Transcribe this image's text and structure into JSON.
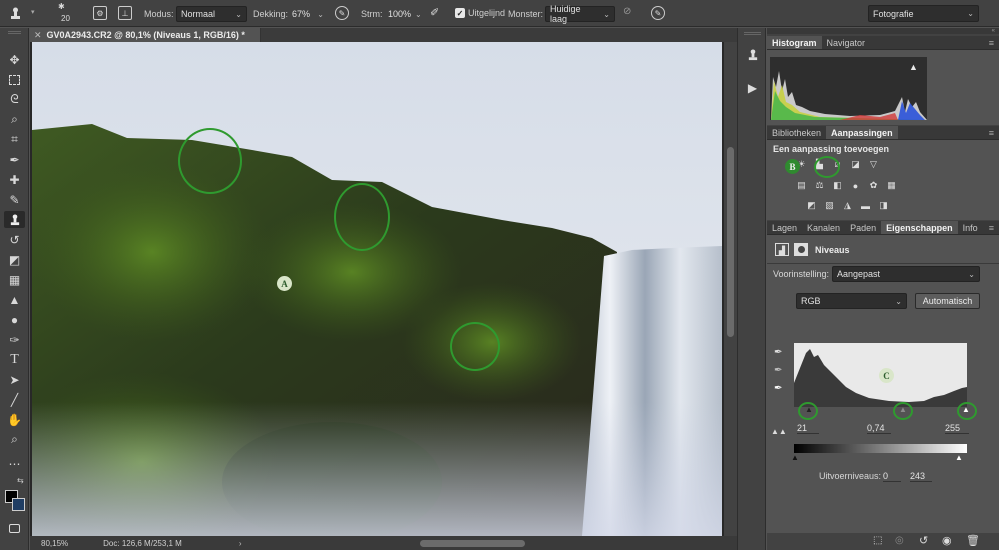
{
  "options_bar": {
    "brush_size": "20",
    "mode_label": "Modus:",
    "mode_value": "Normaal",
    "opacity_label": "Dekking:",
    "opacity_value": "67%",
    "flow_label": "Strm:",
    "flow_value": "100%",
    "aligned_label": "Uitgelijnd",
    "aligned_checked": true,
    "sample_label": "Monster:",
    "sample_value": "Huidige laag",
    "workspace_value": "Fotografie"
  },
  "document": {
    "tab_title": "GV0A2943.CR2 @ 80,1% (Niveaus 1, RGB/16) *",
    "zoom": "80,15%",
    "doc_info": "Doc: 126,6 M/253,1 M",
    "annotation_a": "A"
  },
  "panels": {
    "top_tabs": [
      "Histogram",
      "Navigator"
    ],
    "adjust_tabs": [
      "Bibliotheken",
      "Aanpassingen"
    ],
    "adjust_heading": "Een aanpassing toevoegen",
    "annotation_b": "B",
    "props_tabs": [
      "Lagen",
      "Kanalen",
      "Paden",
      "Eigenschappen",
      "Info"
    ],
    "props_title": "Niveaus",
    "preset_label": "Voorinstelling:",
    "preset_value": "Aangepast",
    "channel_value": "RGB",
    "auto_button": "Automatisch",
    "annotation_c": "C",
    "input_black": "21",
    "input_gamma": "0,74",
    "input_white": "255",
    "output_label": "Uitvoerniveaus:",
    "output_black": "0",
    "output_white": "243"
  },
  "colors": {
    "annotation_green": "#2f9a2f",
    "sky": "#dfe3ea"
  }
}
